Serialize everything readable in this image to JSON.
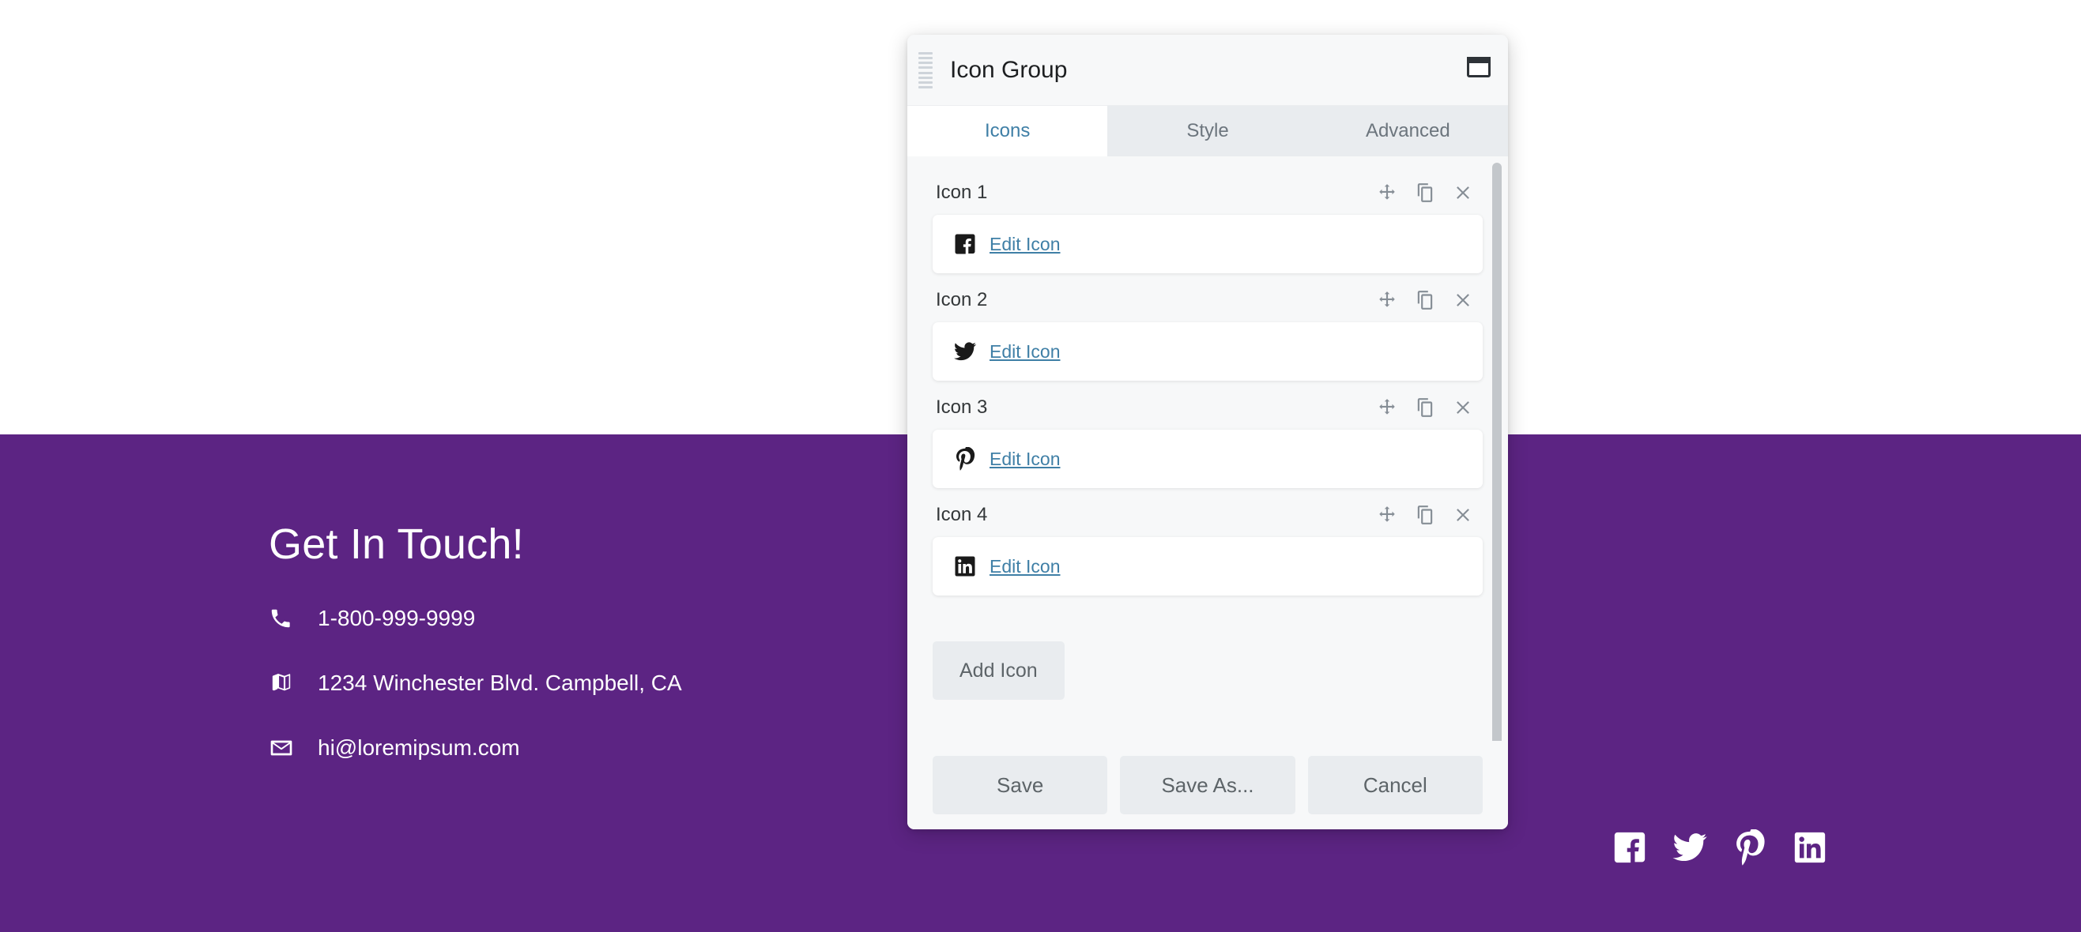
{
  "page": {
    "background_color": "#ffffff",
    "footer_background_color": "#5c2483"
  },
  "footer": {
    "heading": "Get In Touch!",
    "contacts": [
      {
        "icon": "phone-icon",
        "text": "1-800-999-9999"
      },
      {
        "icon": "map-icon",
        "text": "1234 Winchester Blvd. Campbell, CA"
      },
      {
        "icon": "envelope-icon",
        "text": "hi@loremipsum.com"
      }
    ],
    "social_icons": [
      {
        "icon": "facebook-icon",
        "name": "Facebook"
      },
      {
        "icon": "twitter-icon",
        "name": "Twitter"
      },
      {
        "icon": "pinterest-icon",
        "name": "Pinterest"
      },
      {
        "icon": "linkedin-icon",
        "name": "LinkedIn"
      }
    ]
  },
  "modal": {
    "title": "Icon Group",
    "drag_handle_icon": "drag-handle-icon",
    "window_icon": "window-restore-icon",
    "accent_color": "#3f7fa6",
    "tabs": [
      {
        "label": "Icons",
        "active": true
      },
      {
        "label": "Style",
        "active": false
      },
      {
        "label": "Advanced",
        "active": false
      }
    ],
    "row_actions": [
      {
        "icon": "move-icon",
        "title": "Move"
      },
      {
        "icon": "duplicate-icon",
        "title": "Duplicate"
      },
      {
        "icon": "remove-icon",
        "title": "Remove"
      }
    ],
    "icon_blocks": [
      {
        "label": "Icon 1",
        "brand": "facebook-icon",
        "edit_label": "Edit Icon"
      },
      {
        "label": "Icon 2",
        "brand": "twitter-icon",
        "edit_label": "Edit Icon"
      },
      {
        "label": "Icon 3",
        "brand": "pinterest-icon",
        "edit_label": "Edit Icon"
      },
      {
        "label": "Icon 4",
        "brand": "linkedin-icon",
        "edit_label": "Edit Icon"
      }
    ],
    "add_icon_label": "Add Icon",
    "footer_buttons": [
      {
        "label": "Save"
      },
      {
        "label": "Save As..."
      },
      {
        "label": "Cancel"
      }
    ]
  }
}
